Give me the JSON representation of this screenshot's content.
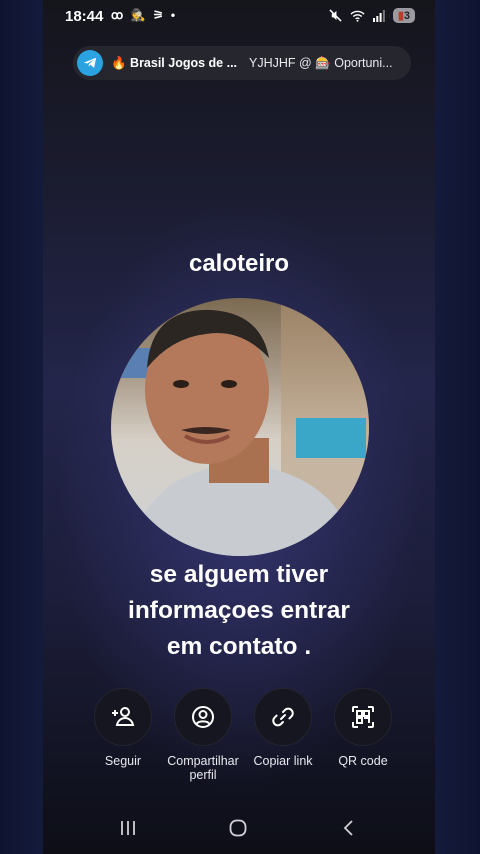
{
  "status_bar": {
    "time": "18:44",
    "left_icons": "ꝏ 🕵 ⚞ •",
    "battery_level": "3"
  },
  "notification": {
    "app_icon": "telegram-icon",
    "title": "🔥 Brasil Jogos de ...",
    "body": "YJHJHF @ 🎰 Oportuni..."
  },
  "profile": {
    "name": "caloteiro",
    "caption_lines": [
      "se alguem tiver",
      "informaçoes entrar",
      "em contato ."
    ]
  },
  "actions": [
    {
      "icon": "add-user-icon",
      "label": "Seguir"
    },
    {
      "icon": "share-profile-icon",
      "label": "Compartilhar perfil"
    },
    {
      "icon": "link-icon",
      "label": "Copiar link"
    },
    {
      "icon": "qr-code-icon",
      "label": "QR code"
    }
  ],
  "navigation": {
    "icons": [
      "recent-apps-icon",
      "home-icon",
      "back-icon"
    ]
  },
  "colors": {
    "telegram": "#2aa3e0",
    "background": "#1c1d3a",
    "text": "#ffffff"
  }
}
